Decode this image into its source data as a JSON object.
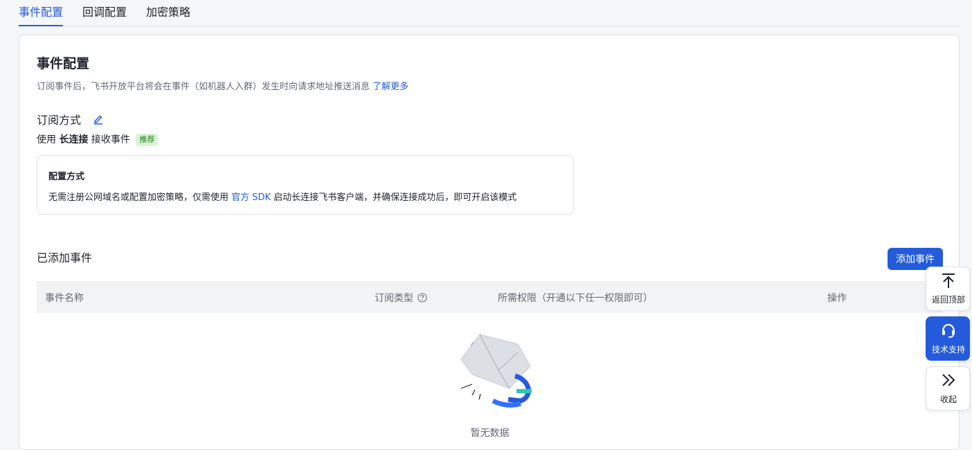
{
  "tabs": [
    "事件配置",
    "回调配置",
    "加密策略"
  ],
  "header": {
    "title": "事件配置",
    "description": "订阅事件后，飞书开放平台将会在事件（如机器人入群）发生时向请求地址推送消息",
    "learn_more": "了解更多"
  },
  "subscription": {
    "title": "订阅方式",
    "use_prefix": "使用",
    "method": "长连接",
    "use_suffix": "接收事件",
    "badge": "推荐"
  },
  "config_box": {
    "title": "配置方式",
    "text_before": "无需注册公网域名或配置加密策略，仅需使用",
    "sdk_link": "官方 SDK",
    "text_after": "启动长连接飞书客户端，并确保连接成功后，即可开启该模式"
  },
  "events": {
    "title": "已添加事件",
    "add_button": "添加事件",
    "columns": [
      "事件名称",
      "订阅类型",
      "所需权限（开通以下任一权限即可）",
      "操作"
    ],
    "empty_text": "暂无数据"
  },
  "float": {
    "back_to_top": "返回顶部",
    "support": "技术支持",
    "collapse": "收起"
  },
  "colors": {
    "accent": "#245bdb",
    "badge_bg": "#d9f5d6",
    "badge_text": "#237b19"
  }
}
